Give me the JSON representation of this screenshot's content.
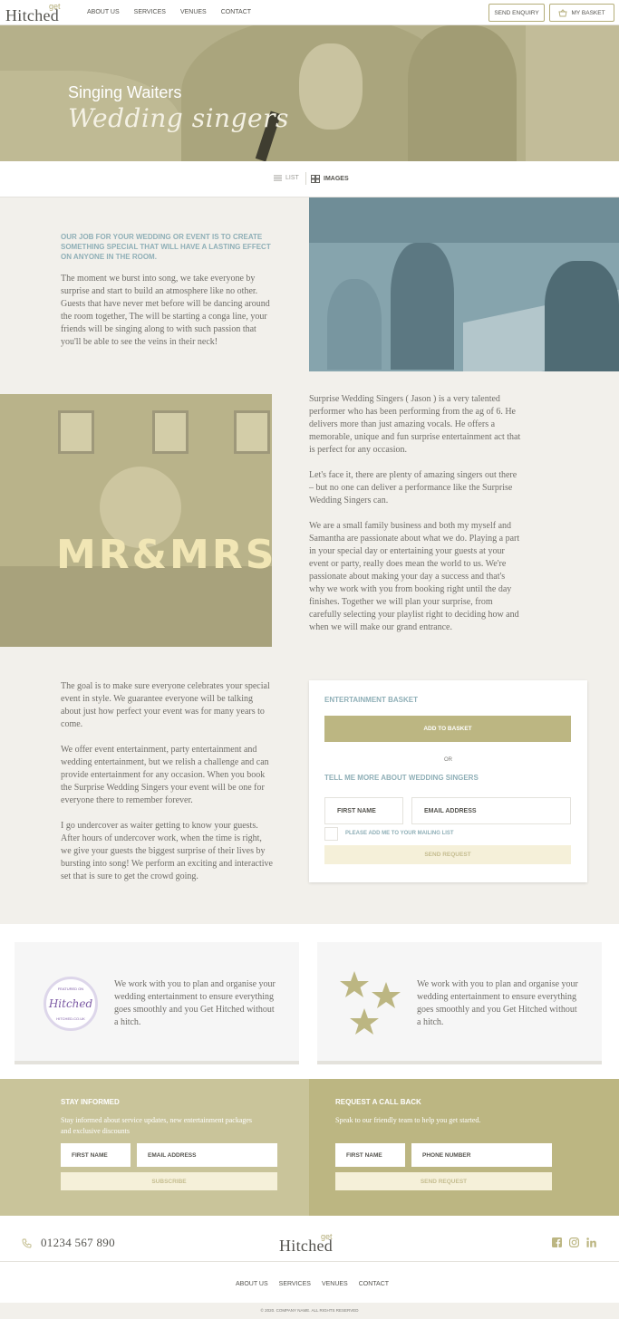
{
  "header": {
    "logo_get": "get",
    "logo_main": "Hitched",
    "nav": [
      "ABOUT US",
      "SERVICES",
      "VENUES",
      "CONTACT"
    ],
    "send_enquiry": "SEND ENQUIRY",
    "my_basket": "MY BASKET"
  },
  "hero": {
    "title": "Singing Waiters",
    "script_title": "Wedding singers"
  },
  "view_toggle": {
    "list": "LIST",
    "images": "IMAGES"
  },
  "section1": {
    "heading": "OUR JOB FOR YOUR WEDDING OR EVENT IS TO CREATE SOMETHING SPECIAL THAT WILL HAVE A LASTING EFFECT ON ANYONE IN THE ROOM.",
    "text": "The moment we burst into song, we take everyone by surprise and start to build an atmosphere like no other. Guests that have never met before will be dancing around the room together, The will be starting a conga line, your friends will be singing along to with such passion that you'll be able to see the veins in their neck!"
  },
  "section2": {
    "image_text": "MR&MRS",
    "paragraphs": [
      "Surprise Wedding Singers ( Jason ) is a very talented performer who has been performing from the ag of 6. He delivers more than just amazing vocals. He offers a memorable, unique and fun surprise entertainment act that is perfect for any occasion.",
      "Let's face it, there are plenty of amazing singers out there – but no one can deliver a performance like the Surprise Wedding Singers can.",
      "We are a small family business and both my myself and Samantha are passionate about what we do. Playing a part in your special day or entertaining your guests at your event or party, really does mean the world to us. We're passionate about making your day a success and that's why we work with you from booking right until the day finishes. Together we will plan your surprise, from carefully selecting your playlist right to deciding how and when we will make our grand entrance."
    ]
  },
  "section3": {
    "paragraphs": [
      "The goal is to make sure everyone celebrates your special event in style. We guarantee everyone will be talking about just how perfect your event was for many years to come.",
      "We offer event entertainment, party entertainment and wedding entertainment, but we relish a challenge and can provide entertainment for any occasion. When you book the Surprise Wedding Singers your event will be one for everyone there to remember forever.",
      "I go undercover as waiter getting to know your guests. After hours of undercover work, when the time is right, we give your guests the biggest surprise of their lives by bursting into song! We perform an exciting and interactive set that is sure to get the crowd going."
    ]
  },
  "basket_card": {
    "heading": "ENTERTAINMENT BASKET",
    "add_button": "ADD TO BASKET",
    "or": "OR",
    "enquiry_heading": "TELL ME MORE ABOUT WEDDING SINGERS",
    "first_name": "FIRST NAME",
    "email": "EMAIL ADDRESS",
    "mailing_list": "PLEASE ADD ME TO YOUR MAILING LIST",
    "send": "SEND REQUEST"
  },
  "features": [
    {
      "text": "We work with you to plan and organise your wedding entertainment to ensure everything goes smoothly and you Get Hitched without a hitch.",
      "badge_top": "FEATURED ON",
      "badge_main": "Hitched",
      "badge_bottom": "HITCHED.CO.UK"
    },
    {
      "text": "We work with you to plan and organise your wedding entertainment to ensure everything goes smoothly and you Get Hitched without a hitch.",
      "icon": "stars-icon"
    }
  ],
  "stay_informed": {
    "heading": "STAY INFORMED",
    "subtext": "Stay informed about service updates, new entertainment packages and exclusive discounts",
    "first_name": "FIRST NAME",
    "email": "EMAIL ADDRESS",
    "button": "SUBSCRIBE"
  },
  "callback": {
    "heading": "REQUEST A CALL BACK",
    "subtext": "Speak to our friendly team to help you get started.",
    "first_name": "FIRST NAME",
    "phone": "PHONE NUMBER",
    "button": "SEND REQUEST"
  },
  "footer": {
    "phone": "01234 567 890",
    "logo_get": "get",
    "logo_main": "Hitched",
    "nav": [
      "ABOUT US",
      "SERVICES",
      "VENUES",
      "CONTACT"
    ],
    "copyright": "© 2020. COMPANY NAME. ALL RIGHTS RESERVED"
  },
  "colors": {
    "accent": "#bcb682",
    "blue_heading": "#8fafb7",
    "background": "#f2f0eb"
  }
}
